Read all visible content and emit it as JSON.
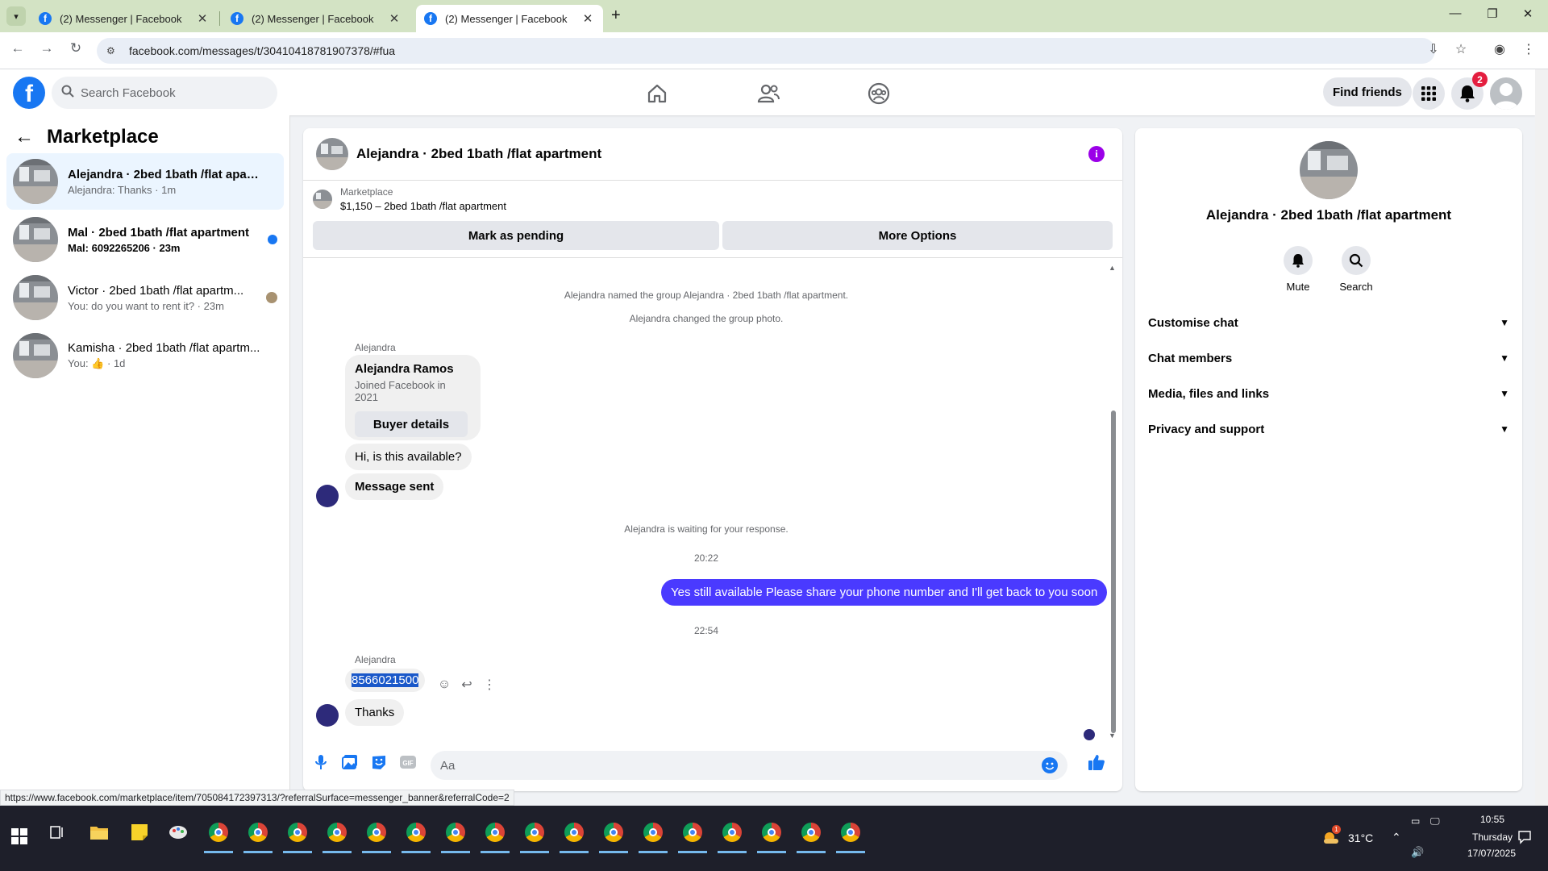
{
  "browser": {
    "tabs": [
      {
        "label": "(2) Messenger | Facebook"
      },
      {
        "label": "(2) Messenger | Facebook"
      },
      {
        "label": "(2) Messenger | Facebook"
      }
    ],
    "url": "facebook.com/messages/t/30410418781907378/#fua"
  },
  "fb_header": {
    "search_placeholder": "Search Facebook",
    "find_friends_label": "Find friends",
    "notification_count": "2"
  },
  "sidebar": {
    "title": "Marketplace",
    "chats": [
      {
        "name": "Alejandra · 2bed 1bath /flat apart...",
        "preview": "Alejandra: Thanks · 1m"
      },
      {
        "name": "Mal · 2bed 1bath /flat apartment",
        "preview": "Mal: 6092265206 · 23m"
      },
      {
        "name": "Victor · 2bed 1bath /flat apartm...",
        "preview": "You: do you want to rent it? · 23m"
      },
      {
        "name": "Kamisha · 2bed 1bath /flat apartm...",
        "preview_prefix": "You:",
        "preview_time": "· 1d"
      }
    ]
  },
  "conversation": {
    "title": "Alejandra · 2bed 1bath /flat apartment",
    "marketplace_label": "Marketplace",
    "listing_desc": "$1,150 – 2bed 1bath /flat apartment",
    "mark_pending_label": "Mark as pending",
    "more_options_label": "More Options",
    "system_named": "Alejandra named the group Alejandra · 2bed 1bath /flat apartment.",
    "system_photo": "Alejandra changed the group photo.",
    "sender_1": "Alejandra",
    "card_name": "Alejandra Ramos",
    "card_sub": "Joined Facebook in 2021",
    "card_button": "Buyer details",
    "msg_available": "Hi, is this available?",
    "msg_sent": "Message sent",
    "system_waiting": "Alejandra is waiting for your response.",
    "time_1": "20:22",
    "msg_out": "Yes still available Please share your phone number and I'll get back to you soon",
    "time_2": "22:54",
    "sender_2": "Alejandra",
    "msg_phone": "8566021500",
    "msg_thanks": "Thanks",
    "composer_placeholder": "Aa"
  },
  "info_panel": {
    "name": "Alejandra · 2bed 1bath /flat apartment",
    "mute_label": "Mute",
    "search_label": "Search",
    "rows": [
      {
        "label": "Customise chat"
      },
      {
        "label": "Chat members"
      },
      {
        "label": "Media, files and links"
      },
      {
        "label": "Privacy and support"
      }
    ]
  },
  "status_url": "https://www.facebook.com/marketplace/item/705084172397313/?referralSurface=messenger_banner&referralCode=2",
  "taskbar": {
    "temperature": "31°C",
    "weather_badge": "1",
    "time": "10:55",
    "day": "Thursday",
    "date": "17/07/2025"
  },
  "colors": {
    "fb_blue": "#1877f2",
    "outgoing_bubble": "#4a3aff",
    "chrome_tabbar": "#d3e3c4",
    "taskbar": "#1e1f2a"
  }
}
